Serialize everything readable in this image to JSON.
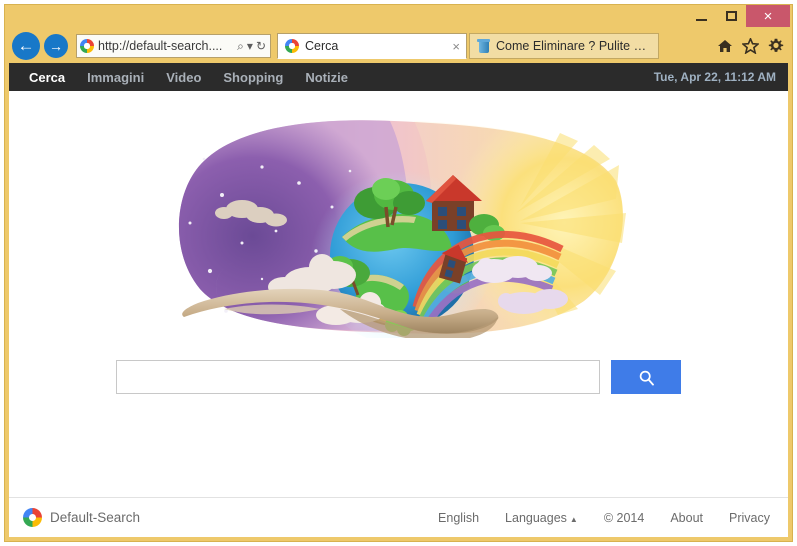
{
  "window": {
    "controls": {
      "minimize_label": "Minimize",
      "maximize_label": "Maximize",
      "close_label": "×"
    }
  },
  "browser": {
    "back_label": "←",
    "forward_label": "→",
    "address": {
      "url_text": "http://default-search....",
      "favicon_name": "default-search-ring-icon",
      "search_glyph": "⌕",
      "dropdown_glyph": "▾",
      "refresh_glyph": "↻"
    },
    "tabs": [
      {
        "title": "Cerca",
        "favicon": "default-search-ring-icon",
        "active": true,
        "close_glyph": "×"
      },
      {
        "title": "Come Eliminare ? Pulite e fat...",
        "favicon": "trash-bin-icon",
        "active": false,
        "close_glyph": ""
      }
    ],
    "toolbar_icons": [
      {
        "name": "home-icon",
        "glyph": "⌂"
      },
      {
        "name": "favorites-star-icon",
        "glyph": "★"
      },
      {
        "name": "settings-gear-icon",
        "glyph": "⚙"
      }
    ]
  },
  "site": {
    "nav_items": [
      {
        "label": "Cerca",
        "active": true
      },
      {
        "label": "Immagini",
        "active": false
      },
      {
        "label": "Video",
        "active": false
      },
      {
        "label": "Shopping",
        "active": false
      },
      {
        "label": "Notizie",
        "active": false
      }
    ],
    "datetime": "Tue, Apr 22, 11:12 AM",
    "search": {
      "value": "",
      "placeholder": "",
      "button_glyph": "⌕",
      "button_name": "search-submit-button"
    },
    "hero": {
      "alt": "Illustration: hand holding a stylized earth globe with houses, trees, rainbow, night sky with moon and stars on the left, sunburst on the right"
    },
    "footer": {
      "brand": "Default-Search",
      "links": [
        {
          "label": "English",
          "caret": ""
        },
        {
          "label": "Languages",
          "caret": "▲"
        },
        {
          "label": "© 2014",
          "caret": ""
        },
        {
          "label": "About",
          "caret": ""
        },
        {
          "label": "Privacy",
          "caret": ""
        }
      ]
    }
  },
  "colors": {
    "frame": "#EEC96B",
    "nav_bar": "#2B2B2B",
    "accent_blue": "#3F7CE8",
    "nav_button_blue": "#1878C8",
    "close_red": "#C9576B",
    "datetime_text": "#9FB1C2"
  }
}
